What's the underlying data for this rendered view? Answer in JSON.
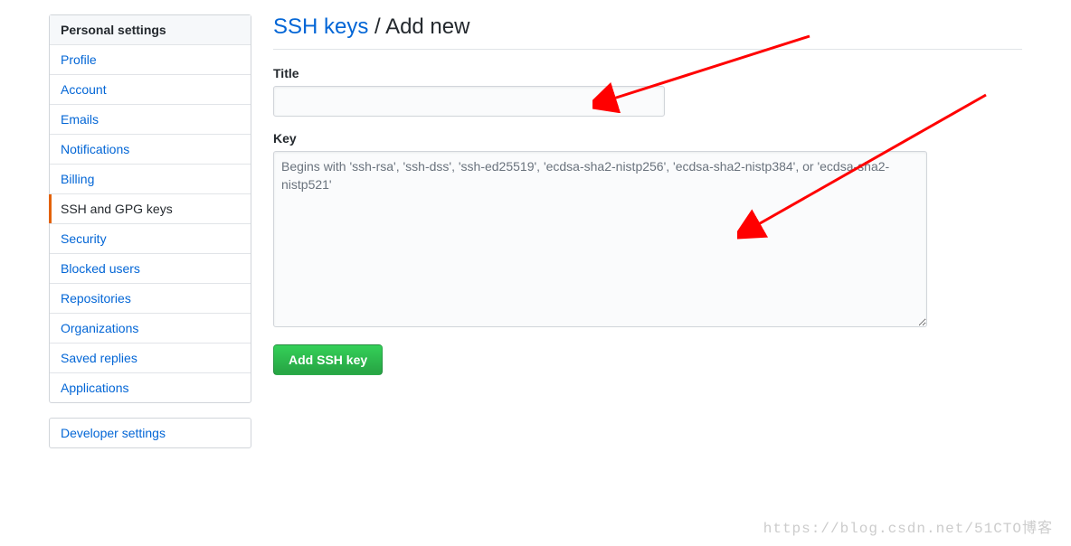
{
  "sidebar": {
    "heading": "Personal settings",
    "items": [
      {
        "label": "Profile",
        "active": false
      },
      {
        "label": "Account",
        "active": false
      },
      {
        "label": "Emails",
        "active": false
      },
      {
        "label": "Notifications",
        "active": false
      },
      {
        "label": "Billing",
        "active": false
      },
      {
        "label": "SSH and GPG keys",
        "active": true
      },
      {
        "label": "Security",
        "active": false
      },
      {
        "label": "Blocked users",
        "active": false
      },
      {
        "label": "Repositories",
        "active": false
      },
      {
        "label": "Organizations",
        "active": false
      },
      {
        "label": "Saved replies",
        "active": false
      },
      {
        "label": "Applications",
        "active": false
      }
    ],
    "developer_link": "Developer settings"
  },
  "page": {
    "heading_link": "SSH keys",
    "heading_sep": " / ",
    "heading_current": "Add new"
  },
  "form": {
    "title_label": "Title",
    "title_value": "",
    "key_label": "Key",
    "key_value": "",
    "key_placeholder": "Begins with 'ssh-rsa', 'ssh-dss', 'ssh-ed25519', 'ecdsa-sha2-nistp256', 'ecdsa-sha2-nistp384', or 'ecdsa-sha2-nistp521'",
    "submit_label": "Add SSH key"
  },
  "watermark": "https://blog.csdn.net/51CTO博客"
}
